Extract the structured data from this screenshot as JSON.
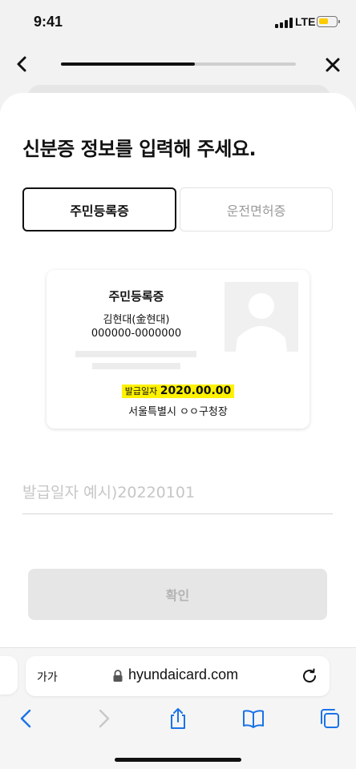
{
  "status_bar": {
    "time": "9:41",
    "network": "LTE"
  },
  "nav": {
    "progress": 0.57
  },
  "page": {
    "title": "신분증 정보를 입력해 주세요."
  },
  "tabs": [
    {
      "label": "주민등록증",
      "selected": true
    },
    {
      "label": "운전면허증",
      "selected": false
    }
  ],
  "id_card": {
    "title": "주민등록증",
    "name": "김현대(金현대)",
    "id_number": "000000-0000000",
    "issue_label": "발급일자",
    "issue_date": "2020.00.00",
    "issuer": "서울특별시 ㅇㅇ구청장"
  },
  "issue_date_input": {
    "value": "",
    "placeholder": "발급일자 예시)20220101"
  },
  "confirm_button": {
    "label": "확인",
    "enabled": false
  },
  "browser": {
    "text_size_label": "가가",
    "url": "hyundaicard.com"
  },
  "colors": {
    "highlight": "#fff200",
    "battery": "#ffcc00",
    "link_blue": "#1a73e8",
    "disabled_button": "#e6e6e6"
  },
  "icons": [
    "back-icon",
    "close-icon",
    "lock-icon",
    "reload-icon",
    "browser-back-icon",
    "browser-forward-icon",
    "share-icon",
    "bookmarks-icon",
    "tabs-icon"
  ]
}
